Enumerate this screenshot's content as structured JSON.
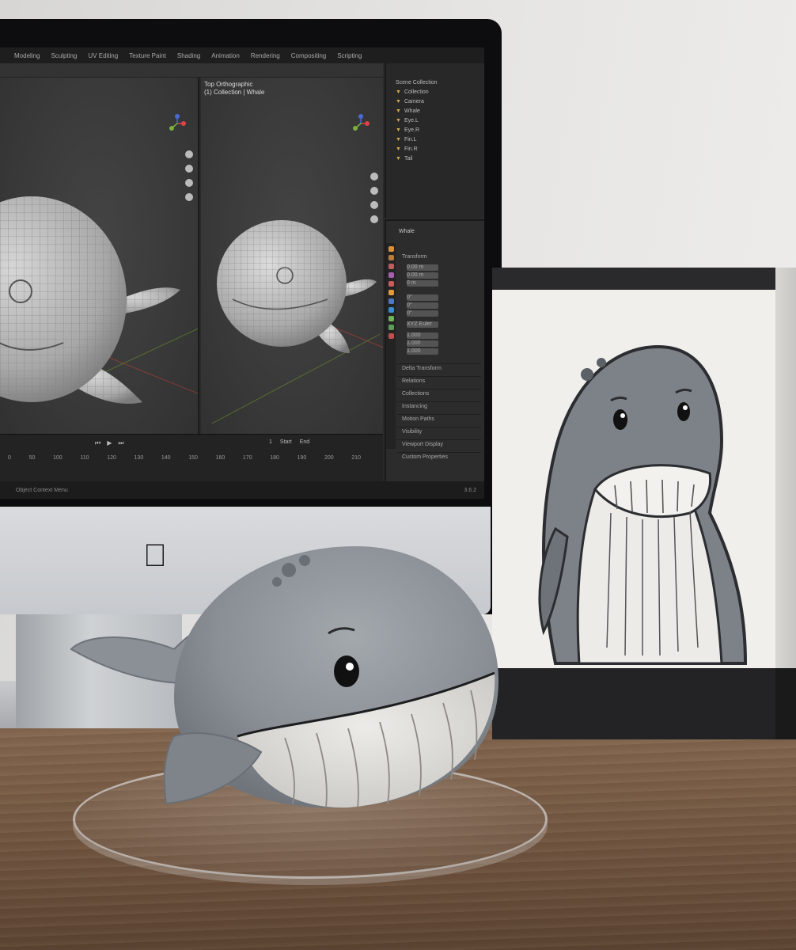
{
  "scene": {
    "colors": {
      "wall": "#e3e2df",
      "desk_wood": "#7a5e48",
      "imac_chin": "#cfd1d4",
      "blender_bg": "#2a2a2a",
      "whale_gray": "#7f848a",
      "whale_belly": "#dedcd8",
      "box_band": "#2a2a2c"
    }
  },
  "blender": {
    "menu": [
      "Modeling",
      "Sculpting",
      "UV Editing",
      "Texture Paint",
      "Shading",
      "Animation",
      "Rendering",
      "Compositing",
      "Scripting"
    ],
    "viewport_left_label": "",
    "viewport_right_label_1": "Top Orthographic",
    "viewport_right_label_2": "(1) Collection | Whale",
    "timeline_ticks": [
      "0",
      "50",
      "100",
      "110",
      "120",
      "130",
      "140",
      "150",
      "160",
      "170",
      "180",
      "190",
      "200",
      "210"
    ],
    "timeline_frame": "1",
    "timeline_start": "Start",
    "timeline_end": "End",
    "outliner_title": "Scene Collection",
    "outliner_items": [
      "Collection",
      "Camera",
      "Whale",
      "Eye.L",
      "Eye.R",
      "Fin.L",
      "Fin.R",
      "Tail"
    ],
    "props_header": "Whale",
    "props_transform_label": "Transform",
    "props_location": [
      "0.00 m",
      "0.00 m",
      "0 m"
    ],
    "props_rotation": [
      "0°",
      "0°",
      "0°"
    ],
    "props_mode": "XYZ Euler",
    "props_scale": [
      "1.000",
      "1.000",
      "1.000"
    ],
    "props_sections": [
      "Delta Transform",
      "Relations",
      "Collections",
      "Instancing",
      "Motion Paths",
      "Visibility",
      "Viewport Display",
      "Custom Properties"
    ],
    "status_text": "Object Context Menu",
    "version": "3.6.2"
  }
}
